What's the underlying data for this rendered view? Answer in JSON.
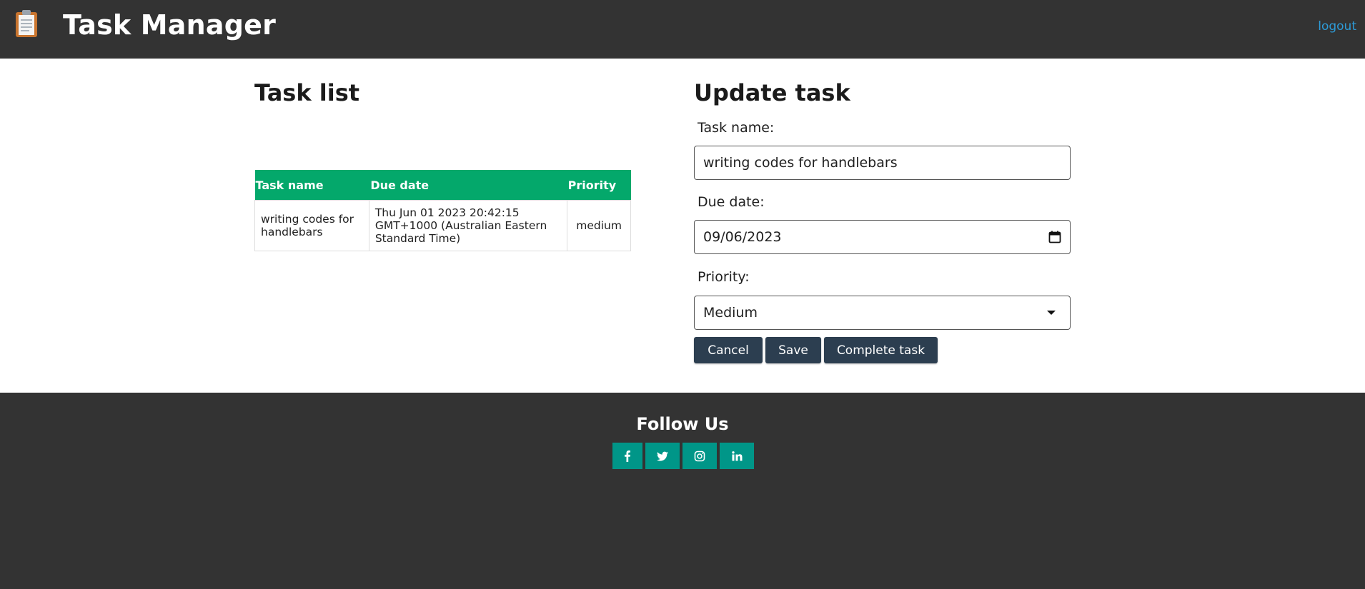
{
  "header": {
    "app_title": "Task Manager",
    "logout_label": "logout",
    "logo_icon": "clipboard-icon"
  },
  "task_list": {
    "title": "Task list",
    "columns": [
      "Task name",
      "Due date",
      "Priority"
    ],
    "rows": [
      {
        "name": "writing codes for handlebars",
        "due": "Thu Jun 01 2023 20:42:15 GMT+1000 (Australian Eastern Standard Time)",
        "priority": "medium"
      }
    ],
    "header_color": "#04a86b"
  },
  "update_task": {
    "title": "Update task",
    "task_name_label": "Task name:",
    "task_name_value": "writing codes for handlebars",
    "due_date_label": "Due date:",
    "due_date_value": "09/06/2023",
    "priority_label": "Priority:",
    "priority_value": "Medium",
    "cancel_label": "Cancel",
    "save_label": "Save",
    "complete_label": "Complete task",
    "button_color": "#2c3e50"
  },
  "footer": {
    "follow_title": "Follow Us",
    "social_icons": [
      "facebook-icon",
      "twitter-icon",
      "instagram-icon",
      "linkedin-icon"
    ],
    "social_color": "#009688"
  },
  "colors": {
    "header_bg": "#333333",
    "link": "#2d9bd7"
  }
}
